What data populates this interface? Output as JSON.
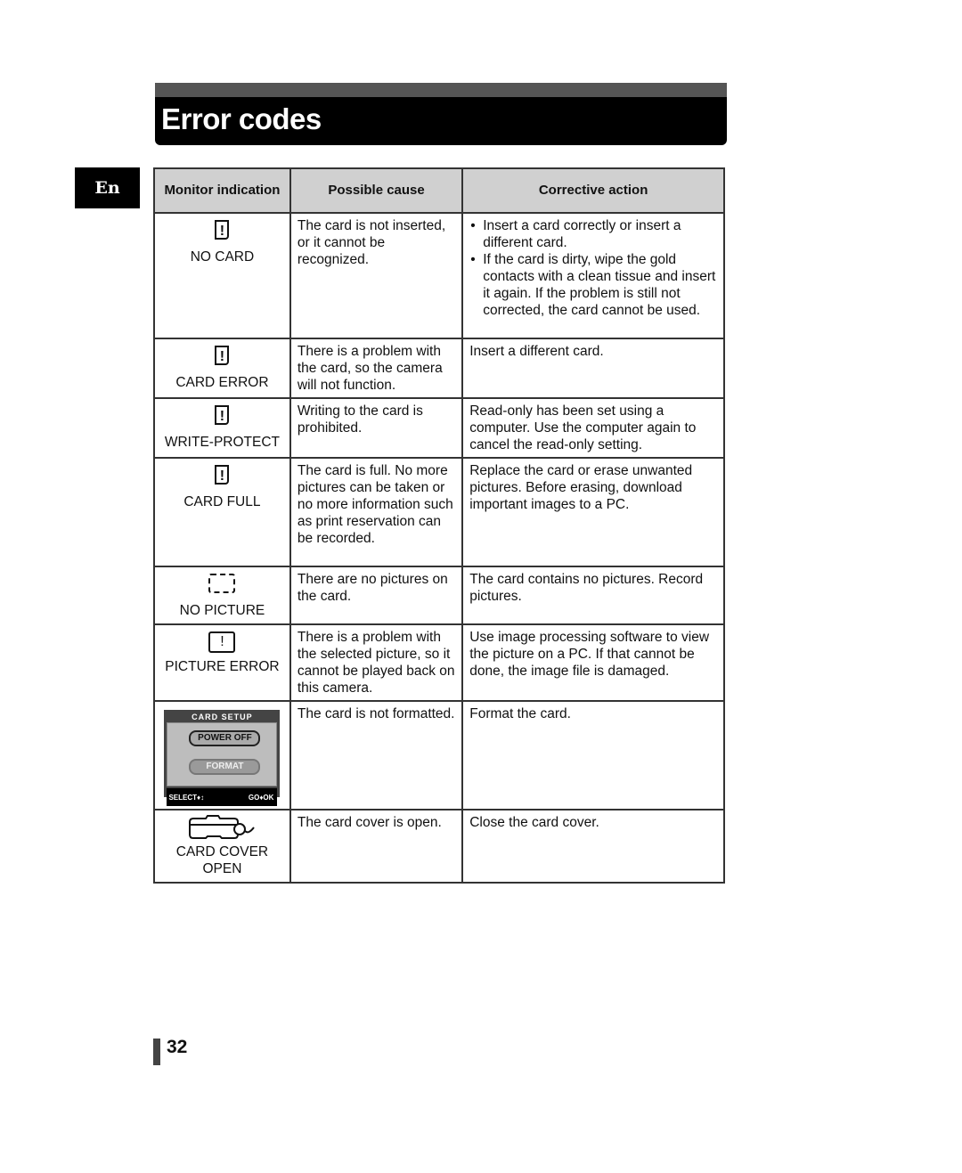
{
  "header": {
    "title": "Error codes"
  },
  "language_tab": "En",
  "table": {
    "headers": {
      "monitor": "Monitor indication",
      "cause": "Possible cause",
      "action": "Corrective action"
    },
    "rows": [
      {
        "icon": "card-warning-icon",
        "monitor": "NO CARD",
        "cause": "The card is not inserted, or it cannot be recognized.",
        "actions": [
          "Insert a card correctly or insert a different card.",
          "If the card is dirty, wipe the gold contacts with a clean tissue and insert it again. If the problem is still not corrected, the card cannot be used."
        ]
      },
      {
        "icon": "card-warning-icon",
        "monitor": "CARD ERROR",
        "cause": "There is a problem with the card, so the camera will not function.",
        "action": "Insert a different card."
      },
      {
        "icon": "card-warning-icon",
        "monitor": "WRITE-PROTECT",
        "cause": "Writing to the card is prohibited.",
        "action": "Read-only has been set using a computer. Use the computer again to cancel the read-only setting."
      },
      {
        "icon": "card-warning-icon",
        "monitor": "CARD FULL",
        "cause": "The card is full. No more pictures can be taken or no more information such as print reservation can be recorded.",
        "action": "Replace the card or erase unwanted pictures. Before erasing, download important images to a PC."
      },
      {
        "icon": "no-picture-icon",
        "monitor": "NO PICTURE",
        "cause": "There are no pictures on the card.",
        "action": "The card contains no pictures. Record pictures."
      },
      {
        "icon": "picture-warning-icon",
        "monitor": "PICTURE ERROR",
        "cause": "There is a problem with the selected picture, so it cannot be played back on this camera.",
        "action": "Use image processing software to view the picture on a PC. If that cannot be done, the image file is damaged."
      },
      {
        "icon": "card-setup-screen",
        "screen": {
          "title": "CARD SETUP",
          "option1": "POWER OFF",
          "option2": "FORMAT",
          "footer_left": "SELECT♦↕",
          "footer_right": "GO♦OK"
        },
        "cause": "The card is not formatted.",
        "action": "Format the card."
      },
      {
        "icon": "card-cover-icon",
        "monitor": "CARD COVER OPEN",
        "cause": "The card cover is open.",
        "action": "Close the card cover."
      }
    ]
  },
  "page_number": "32"
}
